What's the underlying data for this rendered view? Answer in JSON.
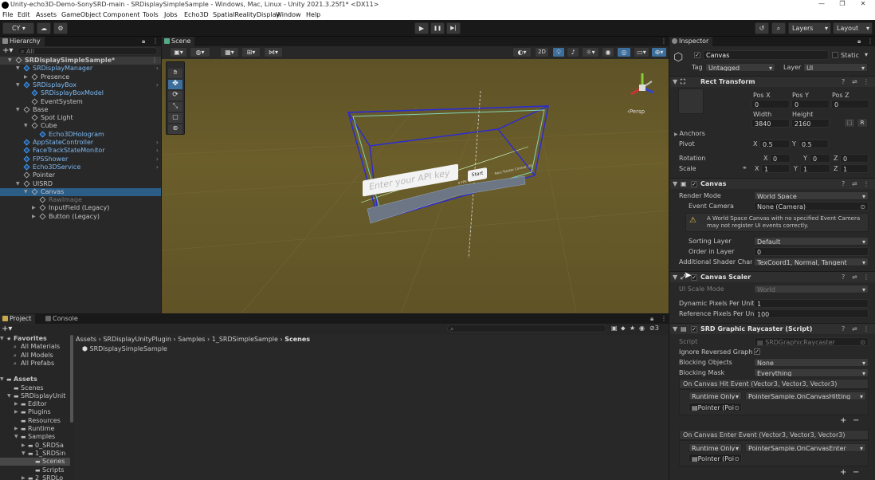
{
  "window": {
    "title": "Unity-echo3D-Demo-SonySRD-main - SRDisplaySimpleSample - Windows, Mac, Linux - Unity 2021.3.25f1* <DX11>",
    "min": "—",
    "max": "❐",
    "close": "✕"
  },
  "menu": [
    "File",
    "Edit",
    "Assets",
    "GameObject",
    "Component",
    "Tools",
    "Jobs",
    "Echo3D",
    "SpatialRealityDisplay",
    "Window",
    "Help"
  ],
  "toolbar": {
    "account": "CY ▾",
    "play": "▶",
    "pause": "❚❚",
    "step": "▶|",
    "layers": "Layers",
    "layout": "Layout"
  },
  "hierarchy": {
    "tab": "Hierarchy",
    "search_placeholder": "All",
    "rows": [
      {
        "label": "SRDisplaySimpleSample*",
        "indent": 0,
        "exp": "▼",
        "icon": "unity",
        "hl": true
      },
      {
        "label": "SRDisplayManager",
        "indent": 1,
        "exp": "▼",
        "icon": "blue"
      },
      {
        "label": "Presence",
        "indent": 2,
        "exp": "▶",
        "icon": "gray"
      },
      {
        "label": "SRDisplayBox",
        "indent": 1,
        "exp": "▼",
        "icon": "blue"
      },
      {
        "label": "SRDisplayBoxModel",
        "indent": 2,
        "exp": "",
        "icon": "blue"
      },
      {
        "label": "EventSystem",
        "indent": 2,
        "exp": "",
        "icon": "gray"
      },
      {
        "label": "Base",
        "indent": 1,
        "exp": "▼",
        "icon": "gray"
      },
      {
        "label": "Spot Light",
        "indent": 2,
        "exp": "",
        "icon": "gray"
      },
      {
        "label": "Cube",
        "indent": 2,
        "exp": "▼",
        "icon": "gray"
      },
      {
        "label": "Echo3DHologram",
        "indent": 3,
        "exp": "",
        "icon": "blue"
      },
      {
        "label": "AppStateController",
        "indent": 1,
        "exp": "",
        "icon": "blue"
      },
      {
        "label": "FaceTrackStateMonitor",
        "indent": 1,
        "exp": "",
        "icon": "blue"
      },
      {
        "label": "FPSShower",
        "indent": 1,
        "exp": "",
        "icon": "blue"
      },
      {
        "label": "Echo3DService",
        "indent": 1,
        "exp": "",
        "icon": "blue"
      },
      {
        "label": "Pointer",
        "indent": 1,
        "exp": "",
        "icon": "gray"
      },
      {
        "label": "UISRD",
        "indent": 1,
        "exp": "▼",
        "icon": "gray"
      },
      {
        "label": "Canvas",
        "indent": 2,
        "exp": "▼",
        "icon": "gray",
        "sel": true
      },
      {
        "label": "RawImage",
        "indent": 3,
        "exp": "",
        "icon": "gray",
        "dim": true
      },
      {
        "label": "InputField (Legacy)",
        "indent": 3,
        "exp": "▶",
        "icon": "gray"
      },
      {
        "label": "Button (Legacy)",
        "indent": 3,
        "exp": "▶",
        "icon": "gray"
      }
    ]
  },
  "scene": {
    "tab": "Scene",
    "mode2d": "2D",
    "persp": "Persp",
    "input_placeholder": "Enter your API key",
    "start_label": "Start",
    "small_text_left": "0 FPS",
    "small_text_right": "Face Tracker Control: 2D"
  },
  "project": {
    "tab": "Project",
    "console_tab": "Console",
    "favorites": {
      "label": "Favorites",
      "items": [
        "All Materials",
        "All Models",
        "All Prefabs"
      ]
    },
    "assets": {
      "label": "Assets",
      "items": [
        {
          "label": "Scenes",
          "indent": 1,
          "exp": ""
        },
        {
          "label": "SRDisplayUnit",
          "indent": 1,
          "exp": "▼"
        },
        {
          "label": "Editor",
          "indent": 2,
          "exp": "▶"
        },
        {
          "label": "Plugins",
          "indent": 2,
          "exp": "▶"
        },
        {
          "label": "Resources",
          "indent": 2,
          "exp": ""
        },
        {
          "label": "Runtime",
          "indent": 2,
          "exp": "▶"
        },
        {
          "label": "Samples",
          "indent": 2,
          "exp": "▼"
        },
        {
          "label": "0_SRDSa",
          "indent": 3,
          "exp": "▶"
        },
        {
          "label": "1_SRDSin",
          "indent": 3,
          "exp": "▼"
        },
        {
          "label": "Scenes",
          "indent": 4,
          "exp": "",
          "sel": true
        },
        {
          "label": "Scripts",
          "indent": 4,
          "exp": ""
        },
        {
          "label": "2_SRDLo",
          "indent": 3,
          "exp": "▶"
        }
      ]
    },
    "breadcrumb": [
      "Assets",
      "SRDisplayUnityPlugin",
      "Samples",
      "1_SRDSimpleSample",
      "Scenes"
    ],
    "files": [
      "SRDisplaySimpleSample"
    ],
    "hidden_count": "3"
  },
  "inspector": {
    "tab": "Inspector",
    "object_name": "Canvas",
    "static_label": "Static",
    "tag_label": "Tag",
    "tag_value": "Untagged",
    "layer_label": "Layer",
    "layer_value": "UI",
    "rect": {
      "title": "Rect Transform",
      "posx_l": "Pos X",
      "posy_l": "Pos Y",
      "posz_l": "Pos Z",
      "posx": "0",
      "posy": "0",
      "posz": "0",
      "w_l": "Width",
      "h_l": "Height",
      "w": "3840",
      "h": "2160",
      "anchors": "Anchors",
      "pivot": "Pivot",
      "pivot_x": "0.5",
      "pivot_y": "0.5",
      "rotation": "Rotation",
      "rx": "0",
      "ry": "0",
      "rz": "0",
      "scale": "Scale",
      "sx": "1",
      "sy": "1",
      "sz": "1"
    },
    "canvas": {
      "title": "Canvas",
      "render_mode_l": "Render Mode",
      "render_mode": "World Space",
      "event_camera_l": "Event Camera",
      "event_camera": "None (Camera)",
      "warning": "A World Space Canvas with no specified Event Camera may not register UI events correctly.",
      "sorting_layer_l": "Sorting Layer",
      "sorting_layer": "Default",
      "order_l": "Order in Layer",
      "order": "0",
      "shader_l": "Additional Shader Chann",
      "shader": "TexCoord1, Normal, Tangent"
    },
    "scaler": {
      "title": "Canvas Scaler",
      "ui_scale_l": "UI Scale Mode",
      "ui_scale": "World",
      "dpp_l": "Dynamic Pixels Per Unit",
      "dpp": "1",
      "rpp_l": "Reference Pixels Per Un",
      "rpp": "100"
    },
    "raycaster": {
      "title": "SRD Graphic Raycaster (Script)",
      "script_l": "Script",
      "script": "SRDGraphicRaycaster",
      "ignore_l": "Ignore Reversed Graphic",
      "blocking_l": "Blocking Objects",
      "blocking": "None",
      "mask_l": "Blocking Mask",
      "mask": "Everything",
      "hit_event": "On Canvas Hit Event (Vector3, Vector3, Vector3)",
      "hit_mode": "Runtime Only",
      "hit_func": "PointerSample.OnCanvasHitting",
      "hit_obj": "Pointer (Poi",
      "enter_event": "On Canvas Enter Event (Vector3, Vector3, Vector3)",
      "enter_mode": "Runtime Only",
      "enter_func": "PointerSample.OnCanvasEnter",
      "enter_obj": "Pointer (Poi",
      "plus": "+",
      "minus": "−"
    }
  },
  "colors": {
    "accent": "#2c5d87",
    "scene_bg": "#6b5e2b",
    "selection": "#2c5d87"
  }
}
